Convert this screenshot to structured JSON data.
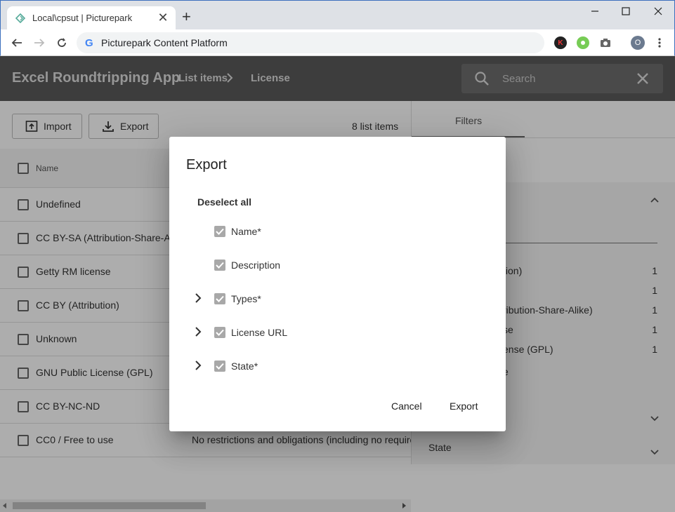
{
  "browser": {
    "tab_title": "Local\\cpsut | Picturepark",
    "address": "Picturepark Content Platform",
    "profile_initial": "O",
    "ext1_initial": "K"
  },
  "header": {
    "app_title": "Excel Roundtripping App",
    "breadcrumb": [
      "List items",
      "License"
    ],
    "search_placeholder": "Search"
  },
  "toolbar": {
    "import_label": "Import",
    "export_label": "Export",
    "count": "8 list items"
  },
  "list": {
    "header_name": "Name",
    "rows": [
      {
        "name": "Undefined",
        "desc": ""
      },
      {
        "name": "CC BY-SA (Attribution-Share-Alike)",
        "desc": ""
      },
      {
        "name": "Getty RM license",
        "desc": ""
      },
      {
        "name": "CC BY (Attribution)",
        "desc": ""
      },
      {
        "name": "Unknown",
        "desc": ""
      },
      {
        "name": "GNU Public License (GPL)",
        "desc": ""
      },
      {
        "name": "CC BY-NC-ND",
        "desc": ""
      },
      {
        "name": "CC0 / Free to use",
        "desc": "No restrictions and obligations (including no requirement"
      }
    ]
  },
  "filters": {
    "tab_label": "Filters",
    "facets": [
      {
        "label": "tion)",
        "count": "1"
      },
      {
        "label": "",
        "count": "1"
      },
      {
        "label": "ribution-Share-Alike)",
        "count": "1"
      },
      {
        "label": "se",
        "count": "1"
      },
      {
        "label": "ense (GPL)",
        "count": "1"
      },
      {
        "label": "e",
        "count": ""
      }
    ],
    "state_label": "State"
  },
  "dialog": {
    "title": "Export",
    "deselect_label": "Deselect all",
    "options": [
      {
        "label": "Name*",
        "expandable": false
      },
      {
        "label": "Description",
        "expandable": false
      },
      {
        "label": "Types*",
        "expandable": true
      },
      {
        "label": "License URL",
        "expandable": true
      },
      {
        "label": "State*",
        "expandable": true
      }
    ],
    "cancel_label": "Cancel",
    "export_label": "Export"
  }
}
